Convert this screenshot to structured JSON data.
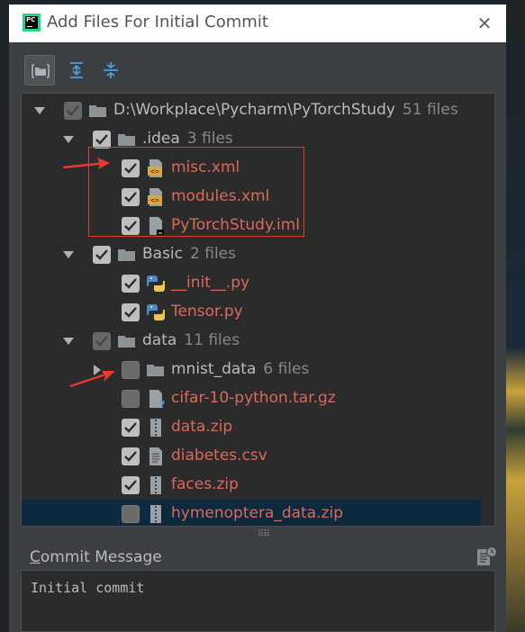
{
  "window": {
    "title": "Add Files For Initial Commit",
    "close_symbol": "✕"
  },
  "toolbar": {
    "buttons": [
      "group-by-directory-icon",
      "expand-all-icon",
      "collapse-all-icon"
    ]
  },
  "tree": {
    "rows": [
      {
        "label": "D:\\Workplace\\Pycharm\\PyTorchStudy",
        "count": "51 files",
        "icon": "folder-icon",
        "state": "partial",
        "expanded": true,
        "color": "normal"
      },
      {
        "label": ".idea",
        "count": "3 files",
        "icon": "folder-icon",
        "state": "checked",
        "expanded": true,
        "color": "normal"
      },
      {
        "label": "misc.xml",
        "icon": "xml-file-icon",
        "state": "checked",
        "color": "unversioned"
      },
      {
        "label": "modules.xml",
        "icon": "xml-file-icon",
        "state": "checked",
        "color": "unversioned"
      },
      {
        "label": "PyTorchStudy.iml",
        "icon": "iml-file-icon",
        "state": "checked",
        "color": "unversioned"
      },
      {
        "label": "Basic",
        "count": "2 files",
        "icon": "folder-icon",
        "state": "checked",
        "expanded": true,
        "color": "normal"
      },
      {
        "label": "__init__.py",
        "icon": "python-file-icon",
        "state": "checked",
        "color": "unversioned"
      },
      {
        "label": "Tensor.py",
        "icon": "python-file-icon",
        "state": "checked",
        "color": "unversioned"
      },
      {
        "label": "data",
        "count": "11 files",
        "icon": "folder-icon",
        "state": "partial",
        "expanded": true,
        "color": "normal"
      },
      {
        "label": "mnist_data",
        "count": "6 files",
        "icon": "folder-icon",
        "state": "unchecked",
        "expanded": false,
        "color": "normal"
      },
      {
        "label": "cifar-10-python.tar.gz",
        "icon": "unknown-file-icon",
        "state": "unchecked",
        "color": "unversioned"
      },
      {
        "label": "data.zip",
        "icon": "archive-file-icon",
        "state": "checked",
        "color": "unversioned"
      },
      {
        "label": "diabetes.csv",
        "icon": "text-file-icon",
        "state": "checked",
        "color": "unversioned"
      },
      {
        "label": "faces.zip",
        "icon": "archive-file-icon",
        "state": "checked",
        "color": "unversioned"
      },
      {
        "label": "hymenoptera_data.zip",
        "icon": "archive-file-icon",
        "state": "unchecked",
        "color": "unversioned",
        "selected": true
      }
    ]
  },
  "commit": {
    "label_first": "C",
    "label_rest": "ommit Message",
    "message": "Initial commit"
  },
  "colors": {
    "unversioned": "#d86b5a",
    "normal": "#bbbbbb",
    "count": "#888888",
    "selection": "#0d293e",
    "annotation": "#e53935"
  }
}
